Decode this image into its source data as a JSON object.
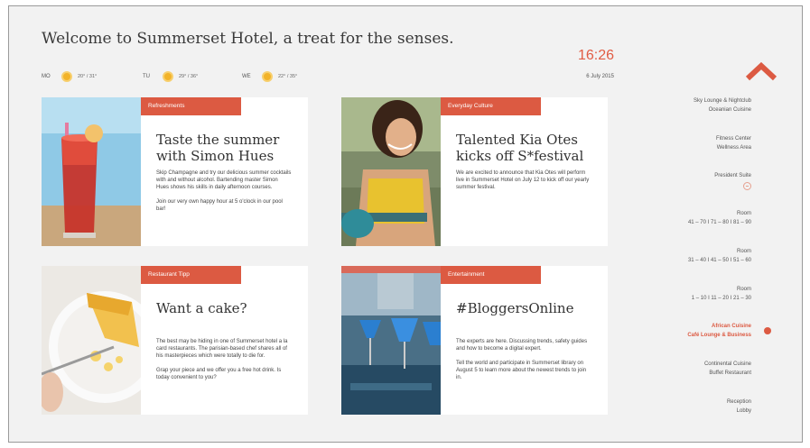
{
  "header": {
    "welcome": "Welcome to Summerset Hotel, a treat for the senses.",
    "time": "16:26",
    "date": "6 July 2015"
  },
  "weather": [
    {
      "day": "MO",
      "temp": "20° / 31°",
      "icon": "sun-icon"
    },
    {
      "day": "TU",
      "temp": "29° / 36°",
      "icon": "sun-icon"
    },
    {
      "day": "WE",
      "temp": "22° / 35°",
      "icon": "sun-icon"
    }
  ],
  "cards": [
    {
      "tag": "Refreshments",
      "title": "Taste the summer with Simon Hues",
      "paragraphs": [
        "Skip Champagne and try our delicious summer cocktails with and without alcohol. Bartending master Simon Hues shows his skills in daily afternoon courses.",
        "Join our very own happy hour at 5 o'clock in our pool bar!"
      ]
    },
    {
      "tag": "Everyday Culture",
      "title": "Talented Kia Otes kicks off S*festival",
      "paragraphs": [
        "We are excited to announce that Kia Otes will perform live in Summerset Hotel on July 12 to kick off our yearly summer festival."
      ]
    },
    {
      "tag": "Restaurant Tipp",
      "title": "Want a cake?",
      "paragraphs": [
        "The best may be hiding in one of Summerset hotel a la card restaurants. The parisian-based chef shares all of his masterpieces which were totally to die for.",
        "Grap your piece and we offer you a free hot drink. Is today convenient to you?"
      ]
    },
    {
      "tag": "Entertainment",
      "title": "#BloggersOnline",
      "paragraphs": [
        "The experts are here. Discussing trends, safety guides and how to become a digital expert.",
        "Tell the world and participate in Summerset library on August 5 to learn more about the newest trends to join in."
      ]
    }
  ],
  "sidebar": {
    "items": [
      {
        "lines": [
          "Sky Lounge & Nightclub",
          "Oceanian Cuisine"
        ]
      },
      {
        "lines": [
          "Fitness Center",
          "Wellness Area"
        ]
      },
      {
        "lines": [
          "President Suite"
        ]
      },
      {
        "lines": [
          "Room",
          "41 – 70  I  71 – 80  I  81 – 90"
        ]
      },
      {
        "lines": [
          "Room",
          "31 – 40  I  41 – 50  I  51 – 60"
        ]
      },
      {
        "lines": [
          "Room",
          "1 – 10  I  11 – 20  I  21 – 30"
        ]
      },
      {
        "lines": [
          "African Cuisine",
          "Café Lounge & Business"
        ]
      },
      {
        "lines": [
          "Continental Cuisine",
          "Buffet Restaurant"
        ]
      },
      {
        "lines": [
          "Reception",
          "Lobby"
        ]
      }
    ]
  },
  "colors": {
    "accent": "#dc5a42",
    "background": "#f2f2f2",
    "card": "#ffffff"
  }
}
